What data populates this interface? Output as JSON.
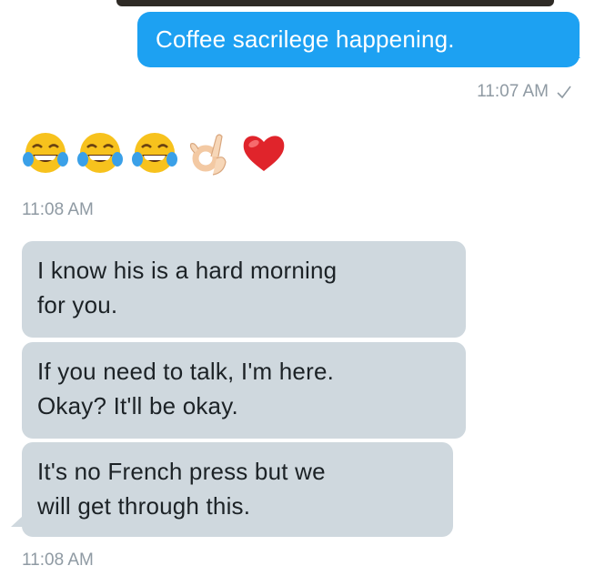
{
  "messages": {
    "outgoing": {
      "text": "Coffee sacrilege happening.",
      "time": "11:07 AM",
      "status_icon": "check-icon"
    },
    "reaction": {
      "emojis": [
        "face-with-tears-of-joy",
        "face-with-tears-of-joy",
        "face-with-tears-of-joy",
        "ok-hand",
        "red-heart"
      ],
      "time": "11:08 AM"
    },
    "incoming": [
      {
        "line1": "I know his is a hard morning",
        "line2": "for you."
      },
      {
        "line1": "If you need to talk, I'm here.",
        "line2": "Okay? It'll be okay."
      },
      {
        "line1": "It's no French press but we",
        "line2": "will get through this."
      }
    ],
    "incoming_time": "11:08 AM"
  },
  "colors": {
    "outgoing_bubble": "#1da1f2",
    "incoming_bubble": "#cfd8de",
    "timestamp": "#8f9aa3"
  }
}
